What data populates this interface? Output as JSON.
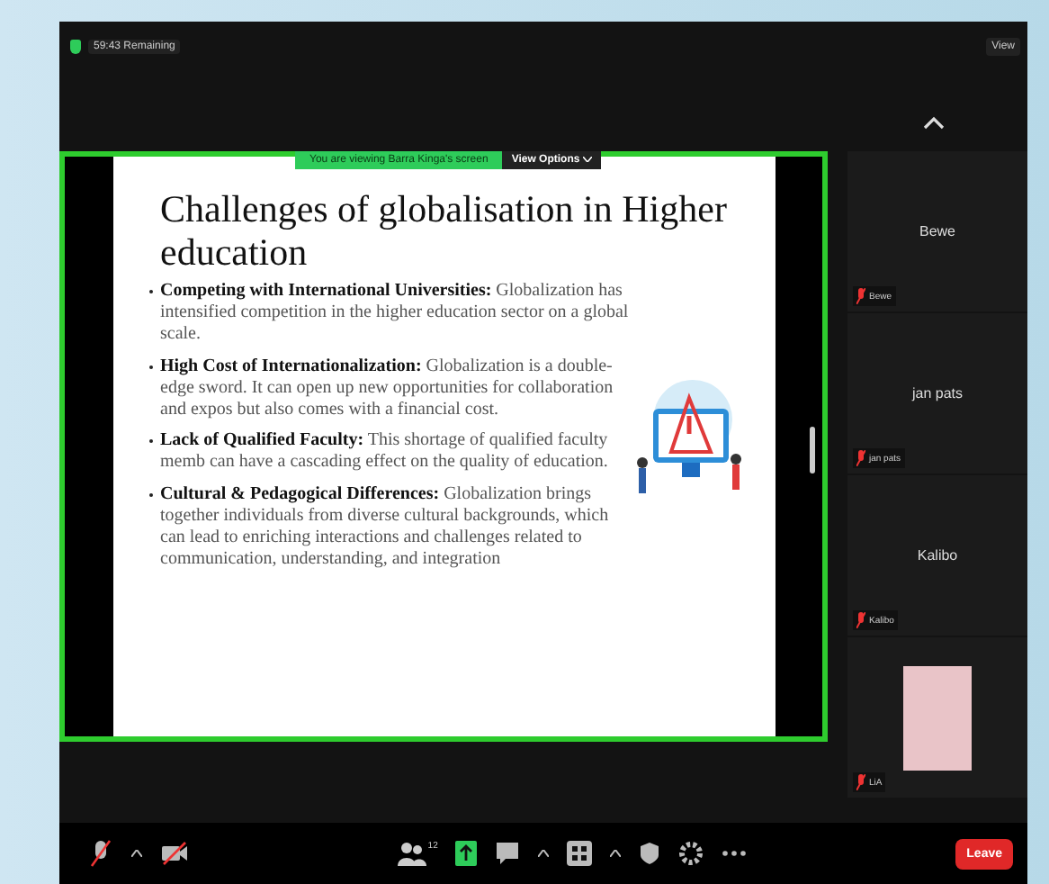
{
  "top_bar": {
    "timer": "59:43 Remaining",
    "view_button": "View"
  },
  "share_banner": {
    "text": "You are viewing Barra Kinga's screen",
    "options_button": "View Options"
  },
  "slide": {
    "title": "Challenges of globalisation in Higher education",
    "bullets": [
      {
        "text": "**Competing with International Universities:** Globalization has intensified competition in the higher education sector on a global scale."
      },
      {
        "text": "**High Cost of Internationalization:** Globalization is a double-edge sword. It can open up new opportunities for collaboration and expos but also comes with a financial cost."
      },
      {
        "text": "**Lack of Qualified Faculty:** This shortage of qualified faculty memb can have a cascading effect on the quality of education."
      },
      {
        "text": "**Cultural & Pedagogical Differences:** Globalization brings together individuals from diverse cultural backgrounds, which can lead to enriching interactions and challenges related to communication, understanding, and integration"
      }
    ]
  },
  "participants": [
    {
      "name": "Bewe",
      "label": "Bewe",
      "kind": "name"
    },
    {
      "name": "jan pats",
      "label": "jan pats",
      "kind": "name"
    },
    {
      "name": "Kalibo",
      "label": "Kalibo",
      "kind": "name"
    },
    {
      "label": "LiA",
      "kind": "picture"
    }
  ],
  "toolbar": {
    "participant_count": "12",
    "leave_button": "Leave"
  }
}
